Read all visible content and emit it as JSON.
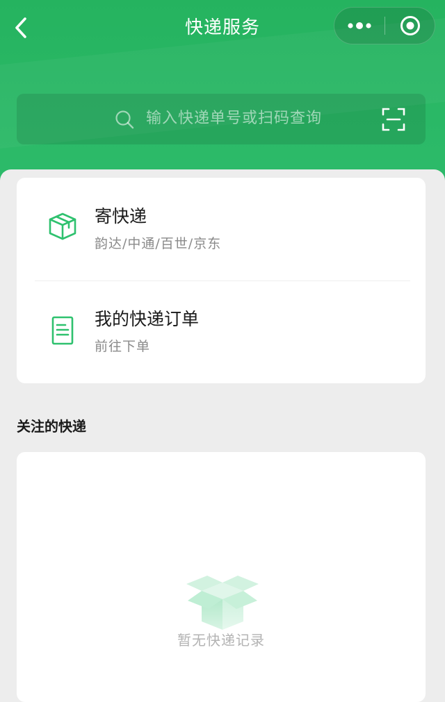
{
  "nav": {
    "title": "快递服务",
    "back_icon": "chevron-left-icon",
    "more_icon": "more-dots-icon",
    "close_icon": "target-close-icon"
  },
  "search": {
    "placeholder": "输入快递单号或扫码查询",
    "search_icon": "search-icon",
    "scan_icon": "scan-icon"
  },
  "services": {
    "items": [
      {
        "title": "寄快递",
        "subtitle": "韵达/中通/百世/京东",
        "icon": "package-box-icon"
      },
      {
        "title": "我的快递订单",
        "subtitle": "前往下单",
        "icon": "document-list-icon"
      }
    ]
  },
  "tracked": {
    "section_title": "关注的快递",
    "empty_text": "暂无快递记录",
    "empty_icon": "empty-box-icon"
  },
  "colors": {
    "brand_green": "#25b35f",
    "icon_green": "#2ec16e",
    "background": "#ededed",
    "card": "#ffffff",
    "text_primary": "#1a1a1a",
    "text_secondary": "#8a8a8a",
    "text_muted": "#b3b3b3"
  }
}
